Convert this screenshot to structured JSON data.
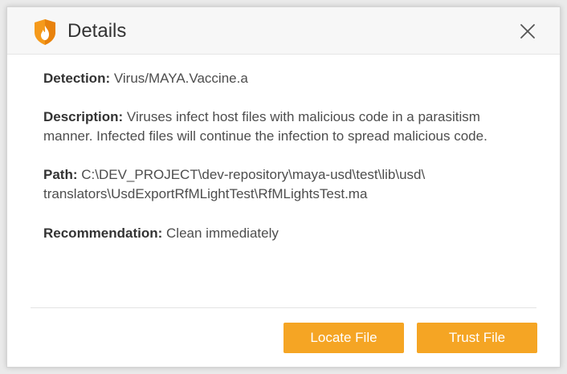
{
  "dialog": {
    "title": "Details",
    "close_icon": "close-icon",
    "logo_icon": "shield-flame-logo",
    "accent_color": "#f5a524"
  },
  "details": {
    "detection_label": "Detection:",
    "detection_value": "Virus/MAYA.Vaccine.a",
    "description_label": "Description:",
    "description_value": "Viruses infect host files with malicious code in a parasitism manner. Infected files will continue the infection to spread malicious code.",
    "path_label": "Path:",
    "path_value_line1": "C:\\DEV_PROJECT\\dev-repository\\maya-usd\\test\\lib\\usd\\",
    "path_value_line2": "translators\\UsdExportRfMLightTest\\RfMLightsTest.ma",
    "recommendation_label": "Recommendation:",
    "recommendation_value": "Clean immediately"
  },
  "buttons": {
    "locate_label": "Locate File",
    "trust_label": "Trust File"
  }
}
